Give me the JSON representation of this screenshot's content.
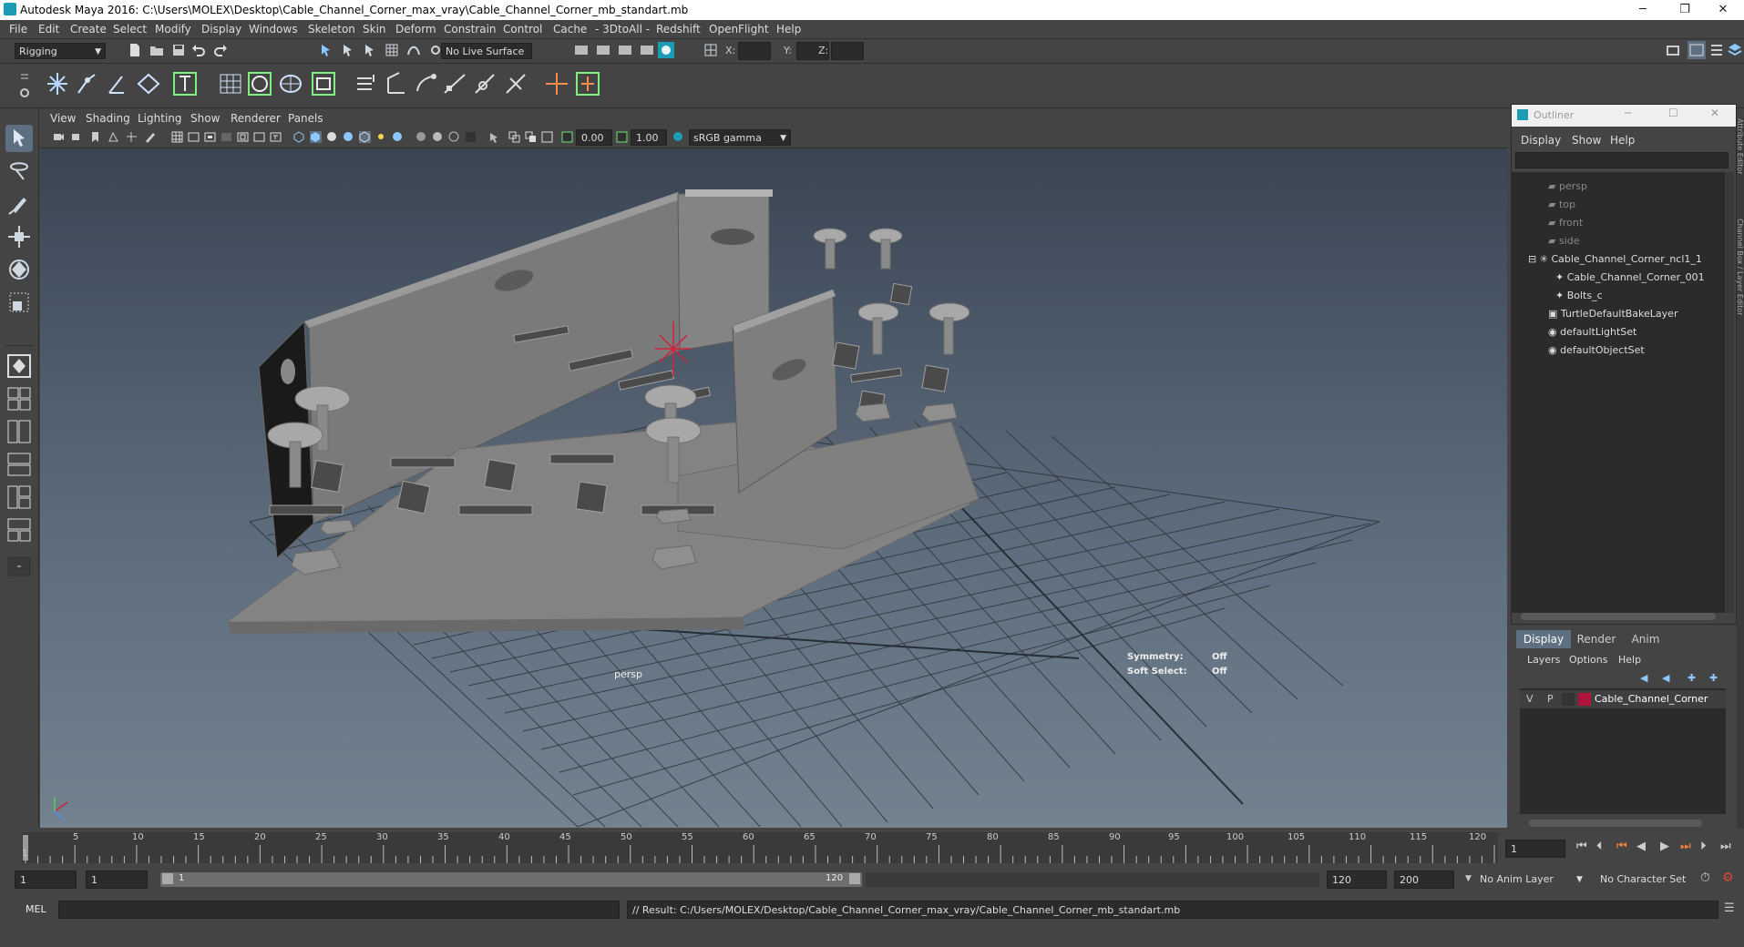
{
  "window": {
    "title": "Autodesk Maya 2016: C:\\Users\\MOLEX\\Desktop\\Cable_Channel_Corner_max_vray\\Cable_Channel_Corner_mb_standart.mb",
    "minimize": "─",
    "maximize": "❐",
    "close": "✕"
  },
  "menubar": [
    "File",
    "Edit",
    "Create",
    "Select",
    "Modify",
    "Display",
    "Windows",
    "Skeleton",
    "Skin",
    "Deform",
    "Constrain",
    "Control",
    "Cache",
    "- 3DtoAll -",
    "Redshift",
    "OpenFlight",
    "Help"
  ],
  "statusline": {
    "menu_set": "Rigging",
    "live_surface": "No Live Surface",
    "x_label": "X:",
    "y_label": "Y:",
    "z_label": "Z:"
  },
  "panel": {
    "menus": [
      "View",
      "Shading",
      "Lighting",
      "Show",
      "Renderer",
      "Panels"
    ],
    "exposure": "0.00",
    "gamma": "1.00",
    "color_space": "sRGB gamma"
  },
  "viewport": {
    "camera": "persp",
    "symmetry_label": "Symmetry:",
    "symmetry_value": "Off",
    "soft_select_label": "Soft Select:",
    "soft_select_value": "Off"
  },
  "outliner": {
    "title": "Outliner",
    "menus": [
      "Display",
      "Show",
      "Help"
    ],
    "items": [
      {
        "label": "persp",
        "dim": true
      },
      {
        "label": "top",
        "dim": true
      },
      {
        "label": "front",
        "dim": true
      },
      {
        "label": "side",
        "dim": true
      },
      {
        "label": "Cable_Channel_Corner_ncl1_1",
        "dim": false
      },
      {
        "label": "Cable_Channel_Corner_001",
        "dim": false
      },
      {
        "label": "Bolts_c",
        "dim": false
      },
      {
        "label": "TurtleDefaultBakeLayer",
        "dim": false
      },
      {
        "label": "defaultLightSet",
        "dim": false
      },
      {
        "label": "defaultObjectSet",
        "dim": false
      }
    ]
  },
  "layer_editor": {
    "tabs": [
      "Display",
      "Render",
      "Anim"
    ],
    "menus": [
      "Layers",
      "Options",
      "Help"
    ],
    "layer": {
      "v": "V",
      "p": "P",
      "name": "Cable_Channel_Corner",
      "color": "#b0143c"
    }
  },
  "side_tabs": {
    "attribute_editor": "Attribute Editor",
    "channel_box": "Channel Box / Layer Editor"
  },
  "timeline": {
    "ticks": [
      "1",
      "5",
      "10",
      "15",
      "20",
      "25",
      "30",
      "35",
      "40",
      "45",
      "50",
      "55",
      "60",
      "65",
      "70",
      "75",
      "80",
      "85",
      "90",
      "95",
      "100",
      "105",
      "110",
      "115",
      "120"
    ],
    "current_frame": "1"
  },
  "range": {
    "start": "1",
    "playback_start": "1",
    "slider_start": "1",
    "slider_end": "120",
    "playback_end": "120",
    "end": "200",
    "anim_layer": "No Anim Layer",
    "character_set": "No Character Set"
  },
  "command": {
    "language": "MEL",
    "result": "// Result: C:/Users/MOLEX/Desktop/Cable_Channel_Corner_max_vray/Cable_Channel_Corner_mb_standart.mb"
  },
  "colors": {
    "accent": "#1c9bb5",
    "active_tab": "#5d6f80",
    "grid": "#2e343b",
    "layer_color": "#b0143c"
  }
}
